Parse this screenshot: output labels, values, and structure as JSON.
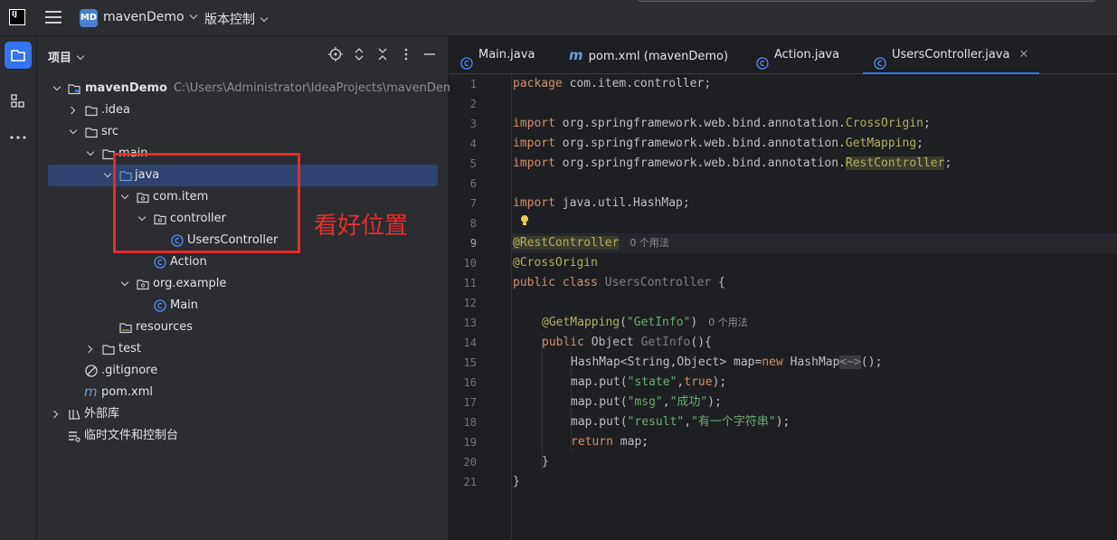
{
  "titlebar": {
    "logo": "IJ",
    "project_badge": "MD",
    "project_name": "mavenDemo",
    "vcs_label": "版本控制"
  },
  "panel": {
    "title": "项目"
  },
  "tree": [
    {
      "label": "mavenDemo",
      "extra": "C:\\Users\\Administrator\\IdeaProjects\\mavenDemo"
    },
    {
      "label": ".idea"
    },
    {
      "label": "src"
    },
    {
      "label": "main"
    },
    {
      "label": "java"
    },
    {
      "label": "com.item"
    },
    {
      "label": "controller"
    },
    {
      "label": "UsersController"
    },
    {
      "label": "Action"
    },
    {
      "label": "org.example"
    },
    {
      "label": "Main"
    },
    {
      "label": "resources"
    },
    {
      "label": "test"
    },
    {
      "label": ".gitignore"
    },
    {
      "label": "pom.xml"
    },
    {
      "label": "外部库"
    },
    {
      "label": "临时文件和控制台"
    }
  ],
  "annotation": "看好位置",
  "tabs": [
    {
      "label": "Main.java"
    },
    {
      "label": "pom.xml (mavenDemo)"
    },
    {
      "label": "Action.java"
    },
    {
      "label": "UsersController.java"
    }
  ],
  "editor": {
    "line_numbers": [
      "1",
      "2",
      "3",
      "4",
      "5",
      "6",
      "7",
      "8",
      "9",
      "10",
      "11",
      "12",
      "13",
      "14",
      "15",
      "16",
      "17",
      "18",
      "19",
      "20",
      "21"
    ],
    "current_line": 9,
    "hint_usages": "0 个用法",
    "code": {
      "l1_kw": "package",
      "l1_rest": " com.item.controller;",
      "l3_kw": "import",
      "l3_pkg": " org.springframework.web.bind.annotation.",
      "l3_cls": "CrossOrigin",
      "l3_end": ";",
      "l4_kw": "import",
      "l4_pkg": " org.springframework.web.bind.annotation.",
      "l4_cls": "GetMapping",
      "l4_end": ";",
      "l5_kw": "import",
      "l5_pkg": " org.springframework.web.bind.annotation.",
      "l5_cls": "RestController",
      "l5_end": ";",
      "l7_kw": "import",
      "l7_rest": " java.util.HashMap;",
      "l9_ann": "@RestController",
      "l10_ann": "@CrossOrigin",
      "l11_kw": "public class",
      "l11_name": " UsersController",
      "l11_rest": " {",
      "l13_ann": "@GetMapping",
      "l13_p1": "(",
      "l13_str": "\"GetInfo\"",
      "l13_p2": ")",
      "l14_kw": "public",
      "l14_type": " Object ",
      "l14_name": "GetInfo",
      "l14_rest": "(){",
      "l15_a": "HashMap<String,Object> map=",
      "l15_kw": "new",
      "l15_b": " HashMap",
      "l15_gen": "<~>",
      "l15_c": "();",
      "l16_a": "map.put(",
      "l16_s": "\"state\"",
      "l16_b": ",",
      "l16_kw": "true",
      "l16_c": ");",
      "l17_a": "map.put(",
      "l17_s1": "\"msg\"",
      "l17_b": ",",
      "l17_s2": "\"成功\"",
      "l17_c": ");",
      "l18_a": "map.put(",
      "l18_s1": "\"result\"",
      "l18_b": ",",
      "l18_s2": "\"有一个字符串\"",
      "l18_c": ");",
      "l19_kw": "return",
      "l19_rest": " map;",
      "l20": "}",
      "l21": "}"
    }
  },
  "colors": {
    "accent": "#3574f0",
    "annotation_red": "#e52d2d",
    "keyword": "#cf8e6d",
    "annotation": "#b3ae60",
    "string": "#6aab73"
  }
}
